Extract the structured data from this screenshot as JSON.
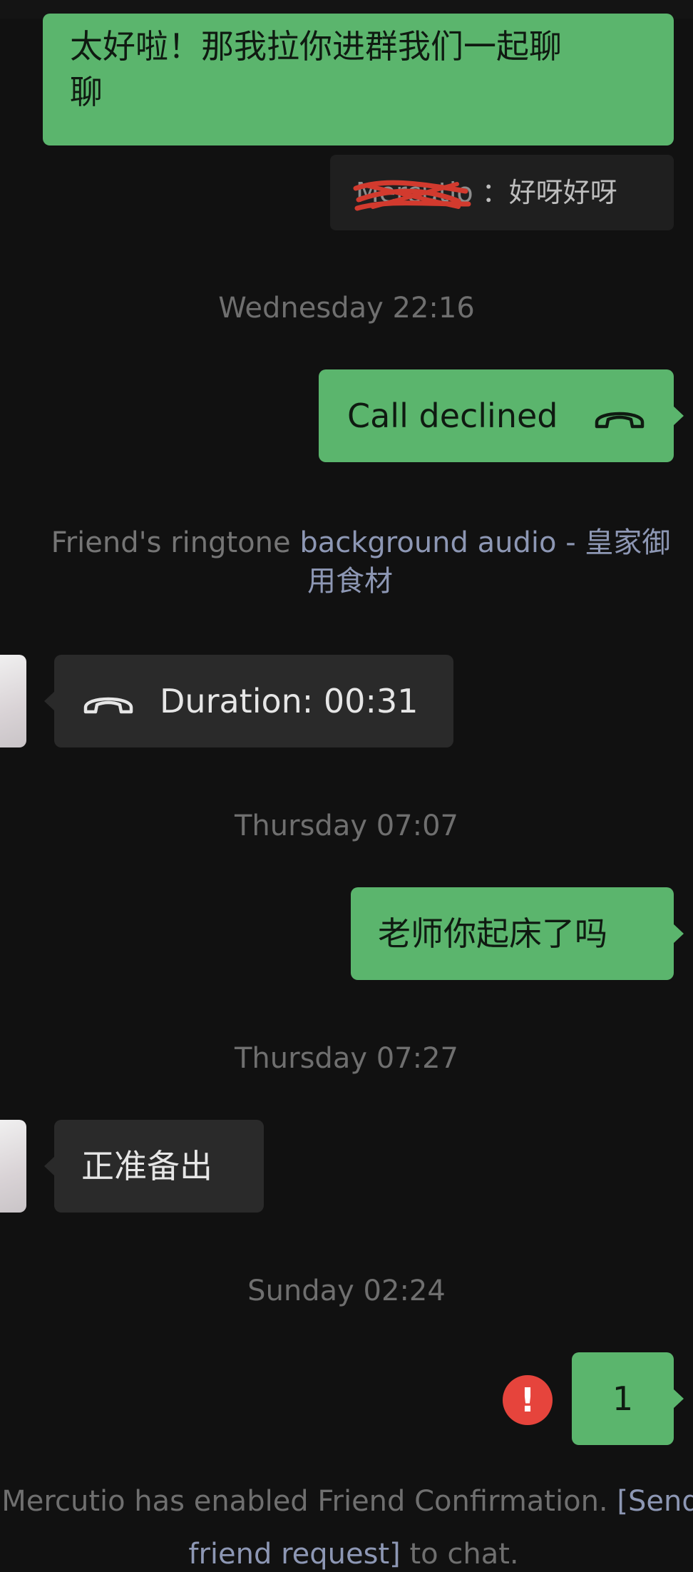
{
  "messages": {
    "m1": {
      "text_line1": "太好啦！那我拉你进群我们一起聊",
      "text_line2": "聊"
    },
    "quote": {
      "name": "Mercutio",
      "separator": "：",
      "text": "好呀好呀"
    },
    "ts1": "Wednesday 22:16",
    "call_declined": {
      "text": "Call declined",
      "icon": "phone-hangup-icon"
    },
    "ringtone": {
      "prefix": "Friend's ringtone ",
      "link_line1": "background audio - 皇家御",
      "link_line2": "用食材"
    },
    "call_duration": {
      "text": "Duration: 00:31",
      "icon": "phone-hangup-icon"
    },
    "ts2": "Thursday 07:07",
    "m_teacher": "老师你起床了吗",
    "ts3": "Thursday 07:27",
    "m_reply": "正准备出",
    "ts4": "Sunday 02:24",
    "m_one": "1",
    "error_badge": "!",
    "system": {
      "line1_text": "Mercutio has enabled Friend Confirmation. ",
      "line1_link": "[Send",
      "line2_link": "friend request]",
      "line2_text": " to chat."
    }
  },
  "colors": {
    "background": "#111111",
    "outgoing_bubble": "#5bb56d",
    "incoming_bubble": "#2a2a2a",
    "timestamp": "#6f6f6f",
    "link": "#8d97b4",
    "error": "#e6443c",
    "strike": "#d23a2e"
  }
}
